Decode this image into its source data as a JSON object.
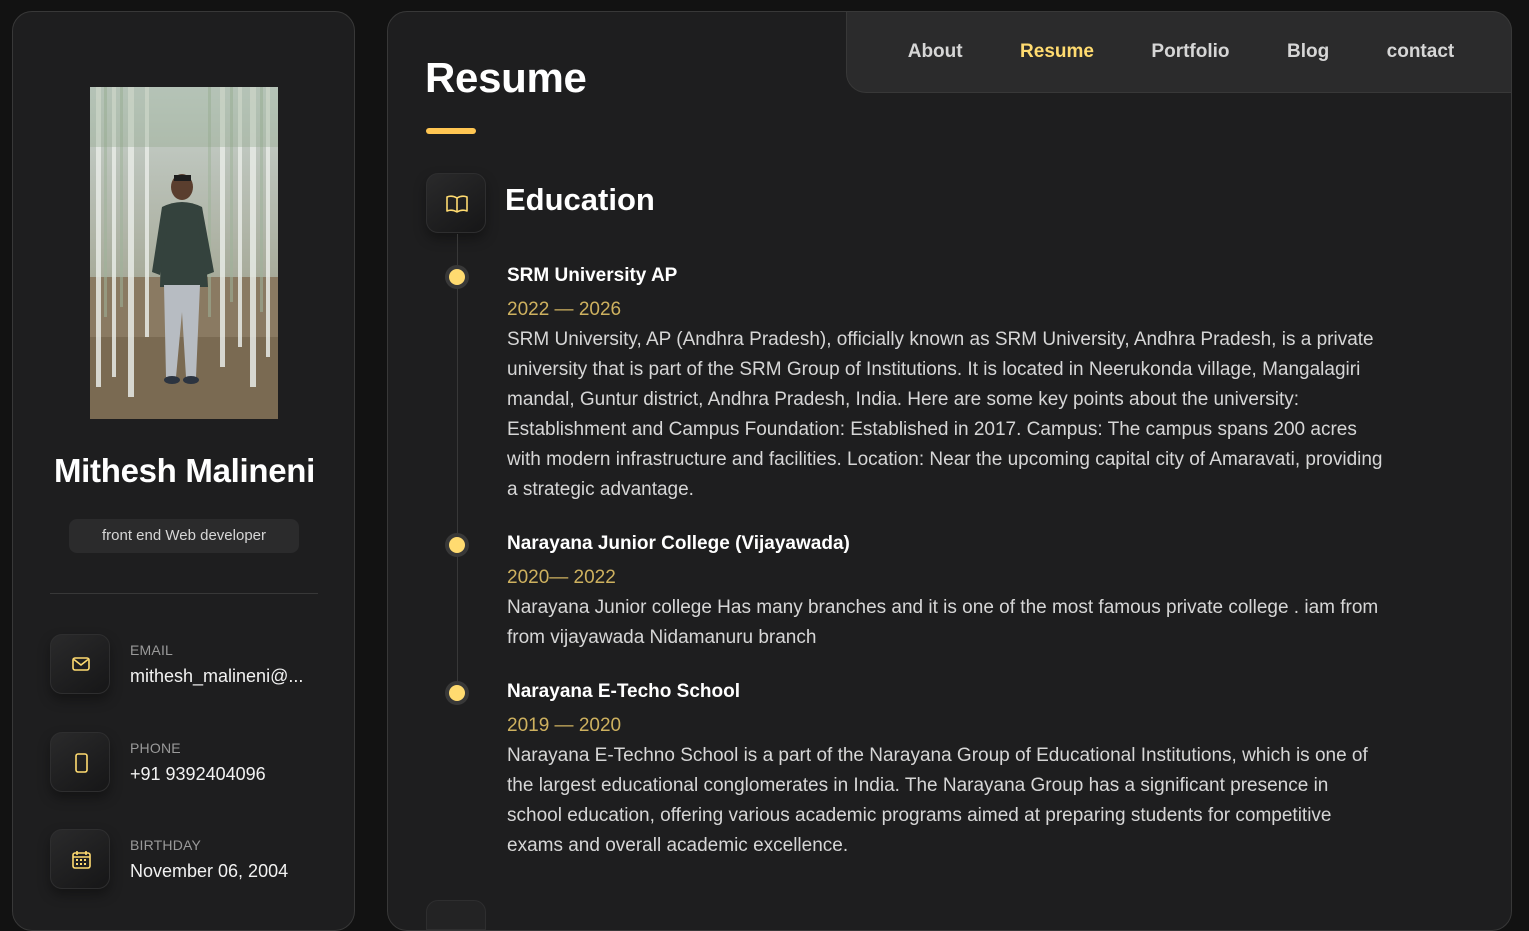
{
  "sidebar": {
    "name": "Mithesh Malineni",
    "title": "front end Web developer",
    "contacts": [
      {
        "label": "EMAIL",
        "value": "mithesh_malineni@...",
        "icon": "mail-icon"
      },
      {
        "label": "PHONE",
        "value": "+91 9392404096",
        "icon": "phone-icon"
      },
      {
        "label": "BIRTHDAY",
        "value": "November 06, 2004",
        "icon": "calendar-icon"
      }
    ]
  },
  "nav": {
    "items": [
      {
        "label": "About"
      },
      {
        "label": "Resume"
      },
      {
        "label": "Portfolio"
      },
      {
        "label": "Blog"
      },
      {
        "label": "contact"
      }
    ],
    "active": "Resume"
  },
  "main": {
    "page_title": "Resume",
    "section_title": "Education",
    "section_icon": "book-icon",
    "timeline": [
      {
        "title": "SRM University AP",
        "date": "2022 — 2026",
        "text": "SRM University, AP (Andhra Pradesh), officially known as SRM University, Andhra Pradesh, is a private university that is part of the SRM Group of Institutions. It is located in Neerukonda village, Mangalagiri mandal, Guntur district, Andhra Pradesh, India. Here are some key points about the university: Establishment and Campus Foundation: Established in 2017. Campus: The campus spans 200 acres with modern infrastructure and facilities. Location: Near the upcoming capital city of Amaravati, providing a strategic advantage."
      },
      {
        "title": "Narayana Junior College (Vijayawada)",
        "date": "2020— 2022",
        "text": "Narayana Junior college Has many branches and it is one of the most famous private college . iam from from vijayawada Nidamanuru branch"
      },
      {
        "title": "Narayana E-Techo School",
        "date": "2019 — 2020",
        "text": "Narayana E-Techno School is a part of the Narayana Group of Educational Institutions, which is one of the largest educational conglomerates in India. The Narayana Group has a significant presence in school education, offering various academic programs aimed at preparing students for competitive exams and overall academic excellence."
      }
    ]
  },
  "colors": {
    "accent": "#ffdb70",
    "date": "#ceb15f",
    "background": "#121212",
    "card": "#1e1e1f"
  }
}
